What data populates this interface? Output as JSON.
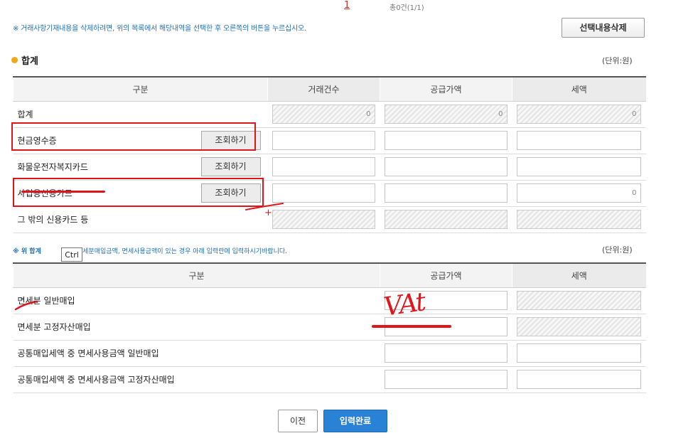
{
  "pagination": {
    "current_page": "1",
    "total_text": "총0건(1/1)"
  },
  "top_notice": "※ 거래사항기재내용을 삭제하려면, 위의 목록에서 해당내역을 선택한 후 오른쪽의 버튼을 누르십시오.",
  "delete_button": "선택내용삭제",
  "summary": {
    "title": "합계",
    "unit": "(단위:원)",
    "headers": [
      "구분",
      "거래건수",
      "공급가액",
      "세액"
    ],
    "rows": [
      {
        "label": "합계",
        "button": "",
        "count": "0",
        "supply": "0",
        "tax": "0"
      },
      {
        "label": "현금영수증",
        "button": "조회하기",
        "count": "",
        "supply": "",
        "tax": ""
      },
      {
        "label": "화물운전자복지카드",
        "button": "조회하기",
        "count": "",
        "supply": "",
        "tax": ""
      },
      {
        "label": "사업용신용카드",
        "button": "조회하기",
        "count": "",
        "supply": "",
        "tax": "0"
      },
      {
        "label": "그 밖의 신용카드 등",
        "button": "",
        "count": "",
        "supply": "",
        "tax": ""
      }
    ]
  },
  "exempt": {
    "notice_bold": "※ 위 합계",
    "notice_rest": "중 면세분매입금액, 면세사용금액이 있는 경우 아래 입력란에 입력하시기바랍니다.",
    "unit": "(단위:원)",
    "headers": [
      "구분",
      "공급가액",
      "세액"
    ],
    "rows": [
      {
        "label": "면세분 일반매입",
        "supply": "",
        "tax": ""
      },
      {
        "label": "면세분 고정자산매입",
        "supply": "",
        "tax": ""
      },
      {
        "label": "공통매입세액 중 면세사용금액 일반매입",
        "supply": "",
        "tax": ""
      },
      {
        "label": "공통매입세액 중 면세사용금액 고정자산매입",
        "supply": "",
        "tax": ""
      }
    ]
  },
  "tooltip": "Ctrl",
  "annotation": {
    "handwritten_text": "VAt",
    "plus_mark": "+"
  },
  "buttons": {
    "prev": "이전",
    "done": "입력완료"
  },
  "colors": {
    "annotation_red": "#e1141c",
    "primary_blue": "#2a82d6",
    "notice_blue": "#1f6fb2",
    "bullet_orange": "#f1a71c"
  }
}
